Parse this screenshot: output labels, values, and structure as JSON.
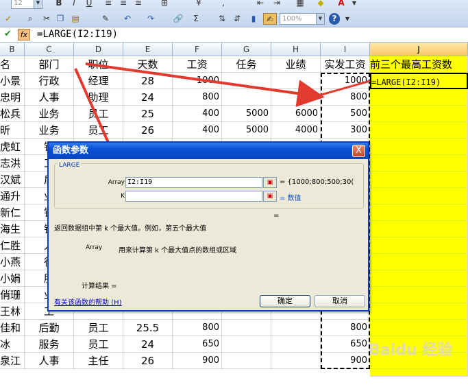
{
  "toolbar": {
    "font_size_value": "12",
    "bold_label": "B",
    "italic_label": "I",
    "underline_label": "U",
    "zoom_value": "100%",
    "help_label": "?",
    "font_color_label": "A",
    "sum_label": "Σ"
  },
  "formula_bar": {
    "fx_label": "fx",
    "formula": "=LARGE(I2:I19)"
  },
  "columns": [
    {
      "name": "B"
    },
    {
      "name": "C"
    },
    {
      "name": "D"
    },
    {
      "name": "E"
    },
    {
      "name": "F"
    },
    {
      "name": "G"
    },
    {
      "name": "H"
    },
    {
      "name": "I"
    },
    {
      "name": "J"
    }
  ],
  "sheet": {
    "headers": [
      "名",
      "部门",
      "职位",
      "天数",
      "工资",
      "任务",
      "业绩",
      "实发工资",
      "前三个最高工资数"
    ],
    "rows": [
      [
        "小景",
        "行政",
        "经理",
        "28",
        "1000",
        "",
        "",
        "1000",
        "=LARGE(I2:I19)"
      ],
      [
        "忠明",
        "人事",
        "助理",
        "24",
        "800",
        "",
        "",
        "800",
        ""
      ],
      [
        "松兵",
        "业务",
        "员工",
        "25",
        "400",
        "5000",
        "6000",
        "500",
        ""
      ],
      [
        "昕",
        "业务",
        "员工",
        "26",
        "400",
        "5000",
        "4000",
        "300",
        ""
      ],
      [
        "虎虹",
        "销",
        "",
        "",
        "",
        "",
        "",
        "",
        ""
      ],
      [
        "志洪",
        "工",
        "",
        "",
        "",
        "",
        "",
        "",
        ""
      ],
      [
        "汉斌",
        "后",
        "",
        "",
        "",
        "",
        "",
        "",
        ""
      ],
      [
        "通升",
        "业",
        "",
        "",
        "",
        "",
        "",
        "",
        ""
      ],
      [
        "新仁",
        "销",
        "",
        "",
        "",
        "",
        "",
        "",
        ""
      ],
      [
        "海生",
        "销",
        "",
        "",
        "",
        "",
        "",
        "",
        ""
      ],
      [
        "仁胜",
        "人",
        "",
        "",
        "",
        "",
        "",
        "",
        ""
      ],
      [
        "小燕",
        "行",
        "",
        "",
        "",
        "",
        "",
        "",
        ""
      ],
      [
        "小娟",
        "服",
        "",
        "",
        "",
        "",
        "",
        "",
        ""
      ],
      [
        "俏珊",
        "业",
        "",
        "",
        "",
        "",
        "",
        "",
        ""
      ],
      [
        "王林",
        "工",
        "",
        "",
        "",
        "",
        "",
        "",
        ""
      ],
      [
        "佳和",
        "后勤",
        "员工",
        "25.5",
        "800",
        "",
        "",
        "800",
        ""
      ],
      [
        "冰",
        "服务",
        "员工",
        "24",
        "650",
        "",
        "",
        "650",
        ""
      ],
      [
        "泉江",
        "人事",
        "主任",
        "26",
        "900",
        "",
        "",
        "900",
        ""
      ]
    ]
  },
  "dialog": {
    "title": "函数参数",
    "close_label": "X",
    "group_label": "LARGE",
    "arg1_label": "Array",
    "arg1_value": "I2:I19",
    "arg1_result": "= {1000;800;500;30(",
    "arg2_label": "K",
    "arg2_value": "",
    "arg2_result": "= 数值",
    "total_result": "=",
    "description": "返回数据组中第 k 个最大值。例如，第五个最大值",
    "param_name": "Array",
    "param_desc": "用来计算第 k 个最大值点的数组或区域",
    "calc_result_label": "计算结果 =",
    "help_link": "有关该函数的帮助 (H)",
    "ok_label": "确定",
    "cancel_label": "取消"
  },
  "watermark": "Baidu 经验",
  "colors": {
    "highlight": "#ffff00",
    "arrow": "#e23a2e",
    "dialog_title": "#0a4fd4"
  }
}
